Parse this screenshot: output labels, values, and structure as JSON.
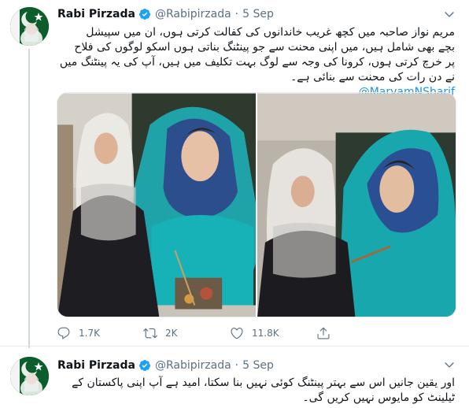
{
  "tweets": [
    {
      "author_name": "Rabi Pirzada",
      "handle": "@Rabipirzada",
      "separator": "·",
      "time": "5 Sep",
      "text_lines": [
        "مریم نواز صاحبہ میں کچھ غریب خاندانوں کی کفالت کرتی ہوں، ان میں سپیشل",
        "بچے بھی شامل ہیں، میں اپنی محنت سے جو پینٹنگ بناتی ہوں اسکو لوگوں کی فلاح",
        "پر خرچ کرتی ہوں، کرونا کی وجہ سے لوگ بہت تکلیف میں ہیں، آپ کی یہ پینٹنگ میں",
        "نے دن رات کی محنت سے بنائی ہے۔"
      ],
      "mention": "@MaryamNSharif",
      "actions": {
        "reply_count": "1.7K",
        "retweet_count": "2K",
        "like_count": "11.8K"
      }
    },
    {
      "author_name": "Rabi Pirzada",
      "handle": "@Rabipirzada",
      "separator": "·",
      "time": "5 Sep",
      "text_lines": [
        "اور یقین جانیں اس سے بہتر پینٹنگ کوئی نہیں بنا سکتا، امید ہے آپ اپنی پاکستان کے",
        "ٹیلینٹ کو مایوس نہیں کریں گی۔"
      ]
    }
  ],
  "colors": {
    "secondary_text": "#5b7083",
    "link": "#1b95e0",
    "verified": "#1da1f2",
    "border": "#e6ecf0"
  },
  "icons": [
    "verified-badge-icon",
    "chevron-down-icon",
    "reply-icon",
    "retweet-icon",
    "like-icon",
    "share-icon"
  ]
}
